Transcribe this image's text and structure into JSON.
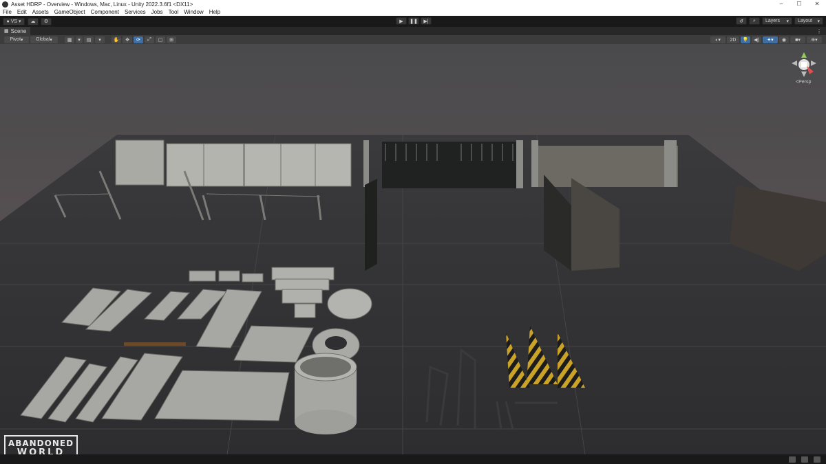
{
  "window": {
    "title": "Asset HDRP - Overview - Windows, Mac, Linux - Unity 2022.3.6f1 <DX11>",
    "minimize": "–",
    "maximize": "☐",
    "close": "✕"
  },
  "menu": [
    "File",
    "Edit",
    "Assets",
    "GameObject",
    "Component",
    "Services",
    "Jobs",
    "Tool",
    "Window",
    "Help"
  ],
  "toolbar": {
    "account_label": "VS",
    "layers_label": "Layers",
    "layout_label": "Layout"
  },
  "scene": {
    "tab_label": "Scene",
    "pivot_label": "Pivot",
    "global_label": "Global",
    "mode_2d_label": "2D",
    "persp_label": "<Persp"
  },
  "watermark": {
    "line1": "ABANDONED",
    "line2": "WORLD"
  },
  "colors": {
    "active_blue": "#3f6ea3",
    "hazard_yellow": "#c9a227"
  }
}
